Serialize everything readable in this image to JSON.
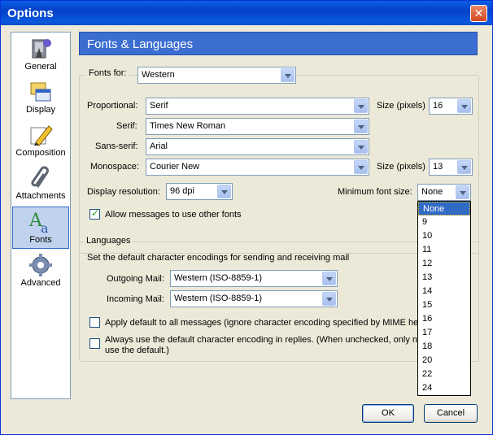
{
  "window": {
    "title": "Options"
  },
  "sidebar": {
    "items": [
      {
        "label": "General",
        "icon": "general-settings-icon"
      },
      {
        "label": "Display",
        "icon": "display-icon"
      },
      {
        "label": "Composition",
        "icon": "pencil-composition-icon"
      },
      {
        "label": "Attachments",
        "icon": "paperclip-icon"
      },
      {
        "label": "Fonts",
        "icon": "fonts-icon",
        "selected": true
      },
      {
        "label": "Advanced",
        "icon": "gear-icon"
      }
    ]
  },
  "header": {
    "title": "Fonts & Languages"
  },
  "fonts": {
    "fonts_for_label": "Fonts for:",
    "fonts_for_value": "Western",
    "proportional_label": "Proportional:",
    "proportional_value": "Serif",
    "size_label": "Size (pixels)",
    "proportional_size": "16",
    "serif_label": "Serif:",
    "serif_value": "Times New Roman",
    "sans_label": "Sans-serif:",
    "sans_value": "Arial",
    "mono_label": "Monospace:",
    "mono_value": "Courier New",
    "mono_size": "13",
    "resolution_label": "Display resolution:",
    "resolution_value": "96 dpi",
    "min_size_label": "Minimum font size:",
    "min_size_value": "None",
    "allow_label": "Allow messages to use other fonts",
    "allow_checked": true
  },
  "languages": {
    "group_label": "Languages",
    "description": "Set the default character encodings for sending and receiving mail",
    "outgoing_label": "Outgoing Mail:",
    "outgoing_value": "Western (ISO-8859-1)",
    "incoming_label": "Incoming Mail:",
    "incoming_value": "Western (ISO-8859-1)",
    "apply_label": "Apply default to all messages (ignore character encoding specified by MIME head",
    "always_label_line1": "Always use the default character encoding in replies. (When unchecked, only ne",
    "always_label_line2": "use the default.)"
  },
  "dropdown": {
    "options": [
      "None",
      "9",
      "10",
      "11",
      "12",
      "13",
      "14",
      "15",
      "16",
      "17",
      "18",
      "20",
      "22",
      "24"
    ],
    "selected": "None"
  },
  "buttons": {
    "ok": "OK",
    "cancel": "Cancel"
  },
  "colors": {
    "titlebar": "#0a58e0",
    "header": "#3c6ed1",
    "selection": "#316ac5",
    "dialog_bg": "#ece9d8"
  }
}
